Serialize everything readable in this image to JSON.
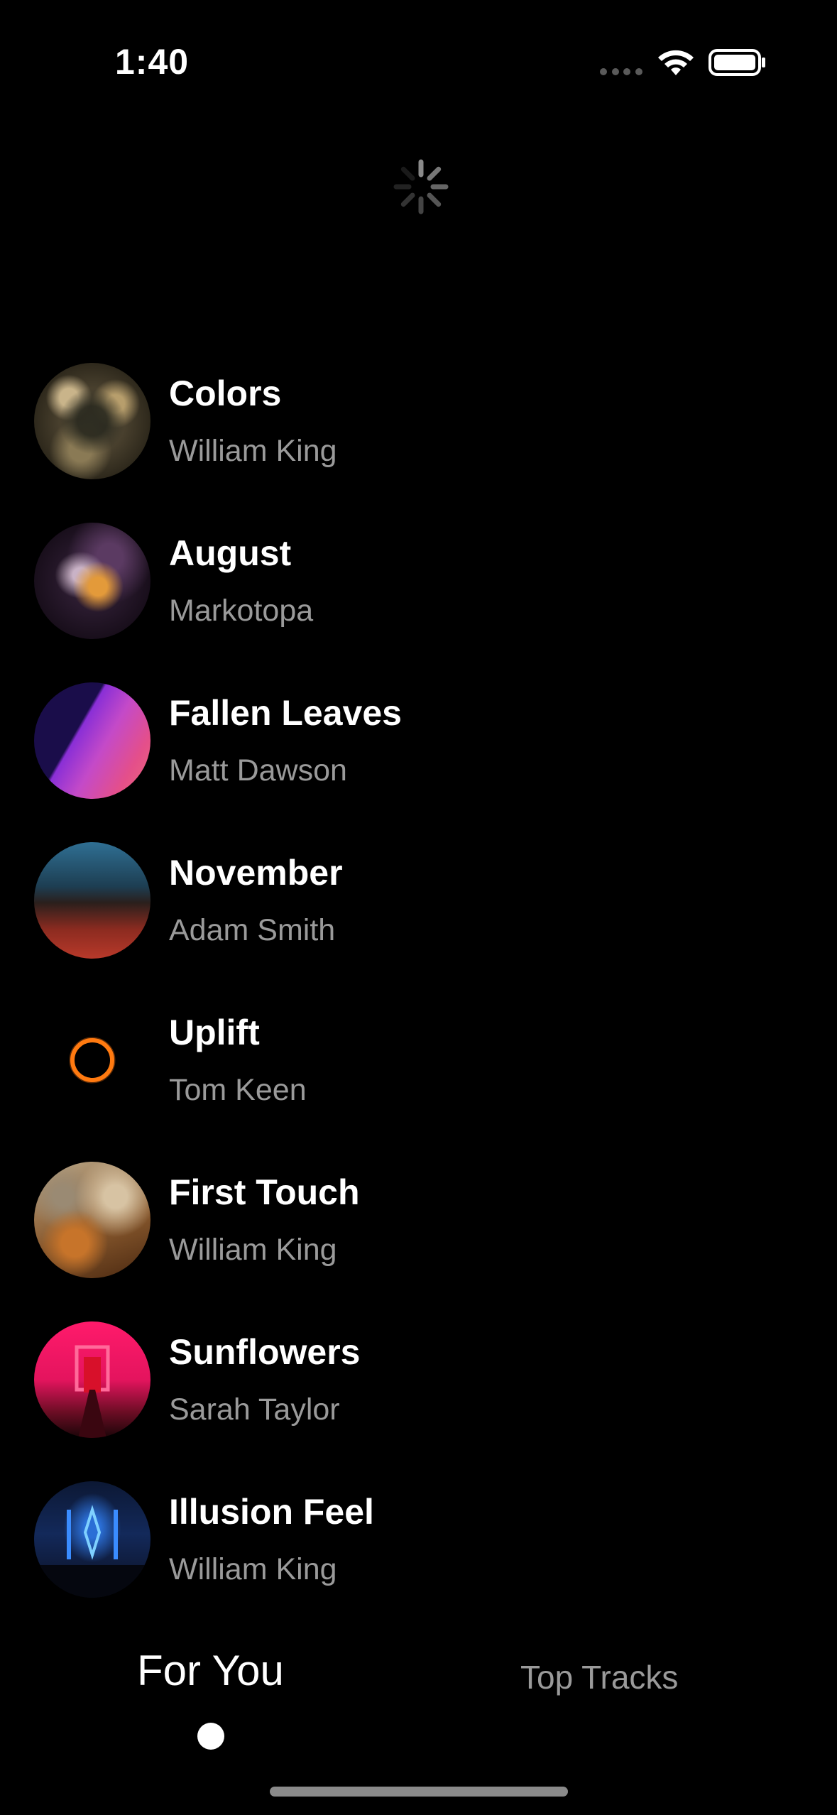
{
  "status_bar": {
    "time": "1:40"
  },
  "tracks": [
    {
      "title": "Colors",
      "artist": "William King"
    },
    {
      "title": "August",
      "artist": "Markotopa"
    },
    {
      "title": "Fallen Leaves",
      "artist": "Matt Dawson"
    },
    {
      "title": "November",
      "artist": "Adam Smith"
    },
    {
      "title": "Uplift",
      "artist": "Tom Keen"
    },
    {
      "title": "First Touch",
      "artist": "William King"
    },
    {
      "title": "Sunflowers",
      "artist": "Sarah Taylor"
    },
    {
      "title": "Illusion Feel",
      "artist": "William King"
    }
  ],
  "tabs": {
    "for_you": "For You",
    "top_tracks": "Top Tracks",
    "selected": "for_you"
  },
  "colors": {
    "background": "#000000",
    "title_text": "#ffffff",
    "artist_text": "#9a9a9a"
  },
  "icons": {
    "wifi": "wifi-icon",
    "battery": "battery-icon",
    "cellular": "cellular-signal-icon",
    "loading": "loading-spinner-icon"
  }
}
